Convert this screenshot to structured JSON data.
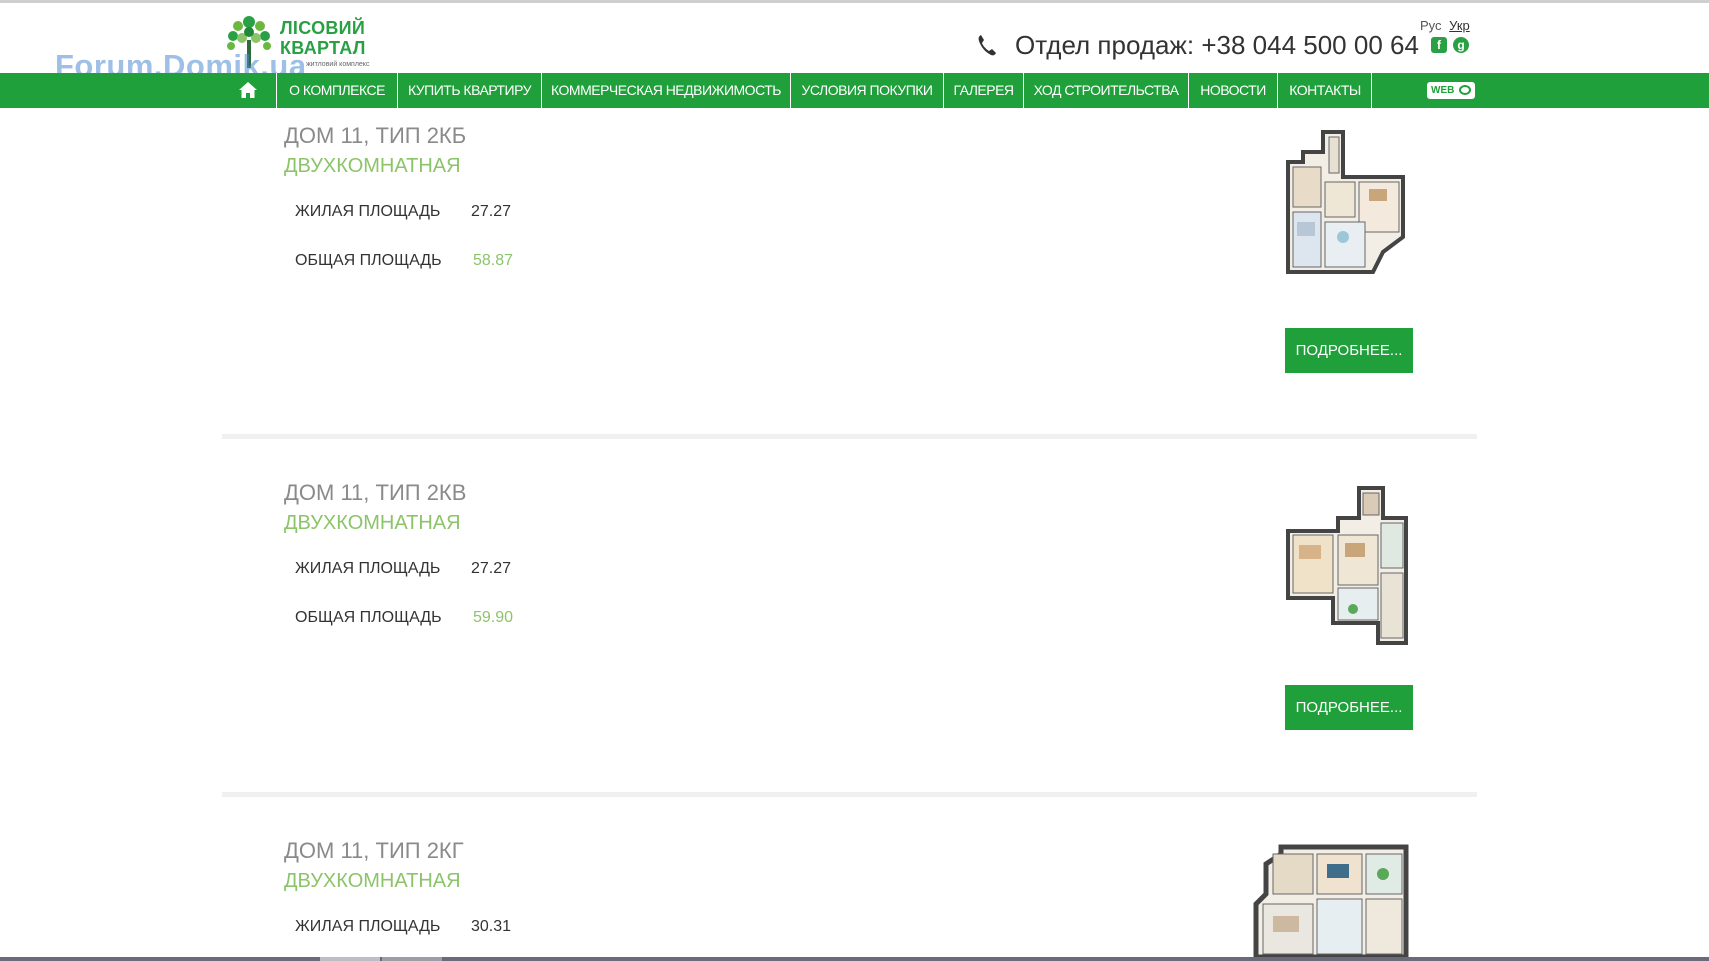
{
  "header": {
    "logo_line1": "ЛІСОВИЙ",
    "logo_line2": "КВАРТАЛ",
    "logo_sub": "житловий комплекс",
    "watermark": "Forum.Domik.ua",
    "phone": "Отдел продаж: +38 044 500 00 64",
    "social_fb": "f",
    "social_gp": "g",
    "lang_ru": "Рус",
    "lang_ua": "Укр"
  },
  "nav": {
    "items": [
      "О КОМПЛЕКСЕ",
      "КУПИТЬ КВАРТИРУ",
      "КОММЕРЧЕСКАЯ НЕДВИЖИМОСТЬ",
      "УСЛОВИЯ ПОКУПКИ",
      "ГАЛЕРЕЯ",
      "ХОД СТРОИТЕЛЬСТВА",
      "НОВОСТИ",
      "КОНТАКТЫ"
    ],
    "web_badge": "WEB"
  },
  "listings": [
    {
      "title": "ДОМ 11, ТИП 2КБ",
      "subtitle": "ДВУХКОМНАТНАЯ",
      "living_label": "ЖИЛАЯ ПЛОЩАДЬ",
      "living_value": "27.27",
      "total_label": "ОБЩАЯ ПЛОЩАДЬ",
      "total_value": "58.87",
      "button": "ПОДРОБНЕЕ..."
    },
    {
      "title": "ДОМ 11, ТИП 2КВ",
      "subtitle": "ДВУХКОМНАТНАЯ",
      "living_label": "ЖИЛАЯ ПЛОЩАДЬ",
      "living_value": "27.27",
      "total_label": "ОБЩАЯ ПЛОЩАДЬ",
      "total_value": "59.90",
      "button": "ПОДРОБНЕЕ..."
    },
    {
      "title": "ДОМ 11, ТИП 2КГ",
      "subtitle": "ДВУХКОМНАТНАЯ",
      "living_label": "ЖИЛАЯ ПЛОЩАДЬ",
      "living_value": "30.31"
    }
  ],
  "colors": {
    "brand_green": "#1fa03b",
    "accent_light_green": "#8cc46a",
    "title_gray": "#8a8a8a"
  }
}
